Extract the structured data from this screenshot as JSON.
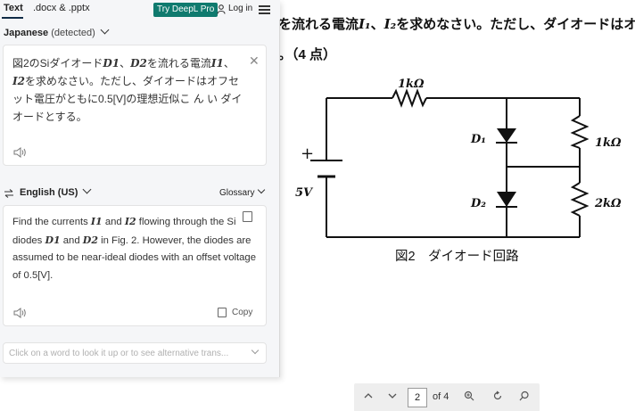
{
  "doc": {
    "line1_prefix": "を流れる電流",
    "i1": "I₁",
    "sep": "、",
    "i2": "I₂",
    "line1_suffix": "を求めなさい。ただし、ダイオードはオ",
    "line2": "。（4 点）",
    "r_top": "1kΩ",
    "voltage": "5V",
    "d1": "D₁",
    "d2": "D₂",
    "r_right1": "1kΩ",
    "r_right2": "2kΩ",
    "caption": "図2　ダイオード回路"
  },
  "toolbar": {
    "page": "2",
    "of": "of 4"
  },
  "panel": {
    "tab_text": "Text",
    "tab_docs": ".docx & .pptx",
    "try_pro": "Try DeepL Pro",
    "login": "Log in",
    "source_lang": "Japanese",
    "detected": "(detected)",
    "close_glyph": "✕",
    "src": {
      "p1": "図2のSiダイオード",
      "d1": "D1",
      "p2": "、",
      "d2": "D2",
      "p3": "を流れる電流",
      "i1": "I1",
      "p4": "、",
      "i2": "I2",
      "p5": "を求めなさい。ただし、ダイオードはオフセット電圧がともに0.5[V]の理想近似こ ん い ダイオードとする。"
    },
    "target_lang": "English (US)",
    "glossary": "Glossary",
    "tgt": {
      "p1": "Find the currents ",
      "i1": "I1",
      "p2": " and ",
      "i2": "I2",
      "p3": " flowing through the Si diodes ",
      "d1": "D1",
      "p4": " and ",
      "d2": "D2",
      "p5": " in Fig. 2. However, the diodes are assumed to be near-ideal diodes with an offset voltage of 0.5[V]."
    },
    "copy": "Copy",
    "lookup": "Click on a word to look it up or to see alternative trans..."
  }
}
